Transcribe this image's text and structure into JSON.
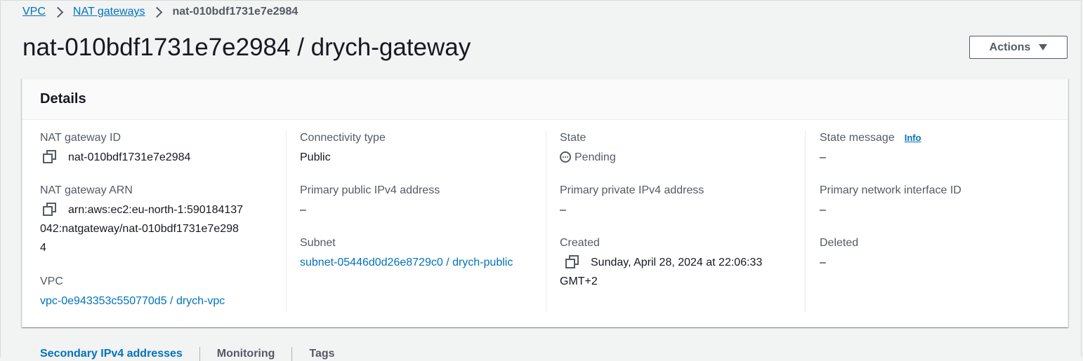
{
  "breadcrumb": {
    "items": [
      "VPC",
      "NAT gateways"
    ],
    "current": "nat-010bdf1731e7e2984"
  },
  "page": {
    "title": "nat-010bdf1731e7e2984 / drych-gateway",
    "actions_label": "Actions"
  },
  "details": {
    "heading": "Details",
    "nat_gateway_id": {
      "label": "NAT gateway ID",
      "value": "nat-010bdf1731e7e2984"
    },
    "nat_gateway_arn": {
      "label": "NAT gateway ARN",
      "value": "arn:aws:ec2:eu-north-1:590184137042:natgateway/nat-010bdf1731e7e2984"
    },
    "vpc": {
      "label": "VPC",
      "value": "vpc-0e943353c550770d5 / drych-vpc"
    },
    "connectivity_type": {
      "label": "Connectivity type",
      "value": "Public"
    },
    "primary_public_ipv4": {
      "label": "Primary public IPv4 address",
      "value": "–"
    },
    "subnet": {
      "label": "Subnet",
      "value": "subnet-05446d0d26e8729c0 / drych-public"
    },
    "state": {
      "label": "State",
      "value": "Pending"
    },
    "primary_private_ipv4": {
      "label": "Primary private IPv4 address",
      "value": "–"
    },
    "created": {
      "label": "Created",
      "value": "Sunday, April 28, 2024 at 22:06:33 GMT+2"
    },
    "state_message": {
      "label": "State message",
      "info": "Info",
      "value": "–"
    },
    "primary_network_interface_id": {
      "label": "Primary network interface ID",
      "value": "–"
    },
    "deleted": {
      "label": "Deleted",
      "value": "–"
    }
  },
  "tabs": [
    "Secondary IPv4 addresses",
    "Monitoring",
    "Tags"
  ],
  "colors": {
    "link": "#0073bb",
    "text": "#16191f",
    "muted": "#545b64",
    "background": "#f2f3f3"
  },
  "icons": [
    "chevron-right-icon",
    "caret-down-icon",
    "copy-icon",
    "pending-icon"
  ]
}
